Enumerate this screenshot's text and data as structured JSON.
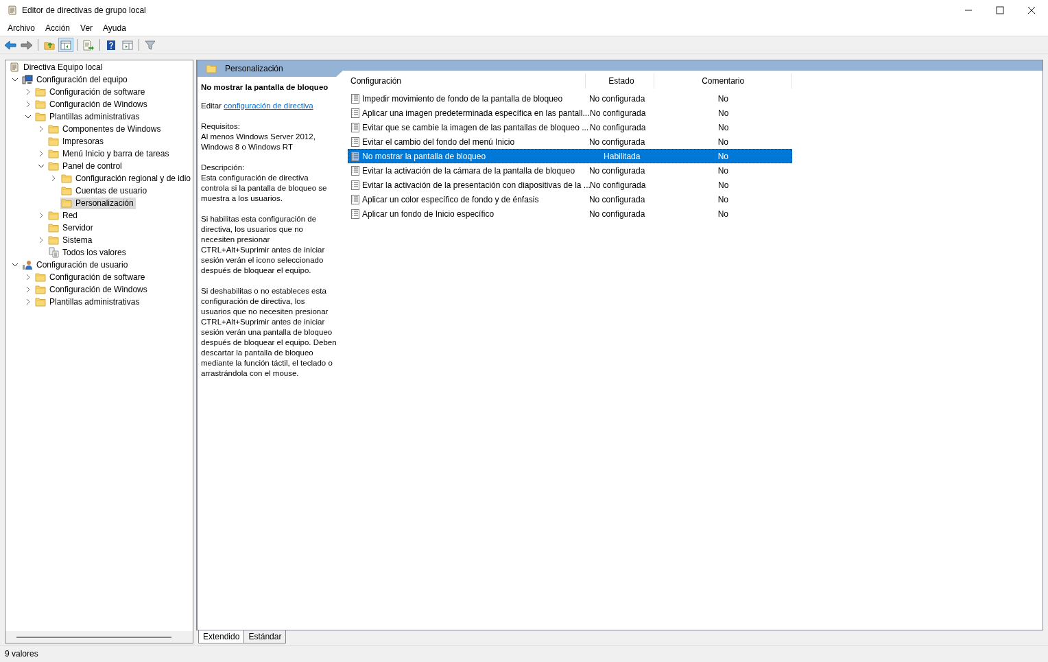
{
  "window": {
    "title": "Editor de directivas de grupo local"
  },
  "menu": [
    "Archivo",
    "Acción",
    "Ver",
    "Ayuda"
  ],
  "toolbar": [
    {
      "kind": "back",
      "selected": false
    },
    {
      "kind": "forward",
      "selected": false
    },
    {
      "kind": "sep"
    },
    {
      "kind": "up",
      "selected": false
    },
    {
      "kind": "tree",
      "selected": true
    },
    {
      "kind": "sep"
    },
    {
      "kind": "export",
      "selected": false
    },
    {
      "kind": "sep"
    },
    {
      "kind": "help",
      "selected": false
    },
    {
      "kind": "pane",
      "selected": false
    },
    {
      "kind": "sep"
    },
    {
      "kind": "filter",
      "selected": false
    }
  ],
  "tree": [
    {
      "label": "Directiva Equipo local",
      "kind": "policy",
      "selected": false,
      "children": [
        {
          "label": "Configuración del equipo",
          "kind": "computer",
          "selected": false,
          "expanded": true,
          "children": [
            {
              "label": "Configuración de software",
              "kind": "folder",
              "selected": false,
              "expanded": false
            },
            {
              "label": "Configuración de Windows",
              "kind": "folder",
              "selected": false,
              "expanded": false
            },
            {
              "label": "Plantillas administrativas",
              "kind": "folder",
              "selected": false,
              "expanded": true,
              "children": [
                {
                  "label": "Componentes de Windows",
                  "kind": "folder",
                  "selected": false,
                  "expanded": false
                },
                {
                  "label": "Impresoras",
                  "kind": "folder",
                  "selected": false
                },
                {
                  "label": "Menú Inicio y barra de tareas",
                  "kind": "folder",
                  "selected": false,
                  "expanded": false
                },
                {
                  "label": "Panel de control",
                  "kind": "folder",
                  "selected": false,
                  "expanded": true,
                  "children": [
                    {
                      "label": "Configuración regional y de idio",
                      "kind": "folder",
                      "selected": false,
                      "expanded": false
                    },
                    {
                      "label": "Cuentas de usuario",
                      "kind": "folder",
                      "selected": false
                    },
                    {
                      "label": "Personalización",
                      "kind": "folder",
                      "selected": true
                    }
                  ]
                },
                {
                  "label": "Red",
                  "kind": "folder",
                  "selected": false,
                  "expanded": false
                },
                {
                  "label": "Servidor",
                  "kind": "folder",
                  "selected": false
                },
                {
                  "label": "Sistema",
                  "kind": "folder",
                  "selected": false,
                  "expanded": false
                },
                {
                  "label": "Todos los valores",
                  "kind": "all",
                  "selected": false
                }
              ]
            }
          ]
        },
        {
          "label": "Configuración de usuario",
          "kind": "user",
          "selected": false,
          "expanded": true,
          "children": [
            {
              "label": "Configuración de software",
              "kind": "folder",
              "selected": false,
              "expanded": false
            },
            {
              "label": "Configuración de Windows",
              "kind": "folder",
              "selected": false,
              "expanded": false
            },
            {
              "label": "Plantillas administrativas",
              "kind": "folder",
              "selected": false,
              "expanded": false
            }
          ]
        }
      ]
    }
  ],
  "header": {
    "title": "Personalización"
  },
  "description": {
    "title": "No mostrar la pantalla de bloqueo",
    "edit_prefix": "Editar",
    "edit_link": "configuración de directiva",
    "blocks": [
      [
        "Requisitos:",
        "Al menos Windows Server 2012, Windows 8 o Windows RT"
      ],
      [
        "Descripción:",
        "Esta configuración de directiva controla si la pantalla de bloqueo se muestra a los usuarios."
      ],
      [
        "Si habilitas esta configuración de directiva, los usuarios que no necesiten presionar CTRL+Alt+Suprimir antes de iniciar sesión verán el icono seleccionado después de bloquear el equipo."
      ],
      [
        "Si deshabilitas o no estableces esta configuración de directiva, los usuarios que no necesiten presionar CTRL+Alt+Suprimir antes de iniciar sesión verán una pantalla de bloqueo después de bloquear el equipo. Deben descartar la pantalla de bloqueo mediante la función táctil, el teclado o arrastrándola con el mouse."
      ]
    ]
  },
  "table": {
    "columns": [
      "Configuración",
      "Estado",
      "Comentario"
    ],
    "rows": [
      {
        "setting": "Impedir movimiento de fondo de la pantalla de bloqueo",
        "state": "No configurada",
        "comment": "No",
        "selected": false
      },
      {
        "setting": "Aplicar una imagen predeterminada específica en las pantall...",
        "state": "No configurada",
        "comment": "No",
        "selected": false
      },
      {
        "setting": "Evitar que se cambie la imagen de las pantallas de bloqueo ...",
        "state": "No configurada",
        "comment": "No",
        "selected": false
      },
      {
        "setting": "Evitar el cambio del fondo del menú Inicio",
        "state": "No configurada",
        "comment": "No",
        "selected": false
      },
      {
        "setting": "No mostrar la pantalla de bloqueo",
        "state": "Habilitada",
        "comment": "No",
        "selected": true
      },
      {
        "setting": "Evitar la activación de la cámara de la pantalla de bloqueo",
        "state": "No configurada",
        "comment": "No",
        "selected": false
      },
      {
        "setting": "Evitar la activación de la presentación con diapositivas de la ...",
        "state": "No configurada",
        "comment": "No",
        "selected": false
      },
      {
        "setting": "Aplicar un color específico de fondo y de énfasis",
        "state": "No configurada",
        "comment": "No",
        "selected": false
      },
      {
        "setting": "Aplicar un fondo de Inicio específico",
        "state": "No configurada",
        "comment": "No",
        "selected": false
      }
    ]
  },
  "view_tabs": [
    {
      "label": "Extendido",
      "selected": true
    },
    {
      "label": "Estándar",
      "selected": false
    }
  ],
  "status_bar": "9 valores"
}
